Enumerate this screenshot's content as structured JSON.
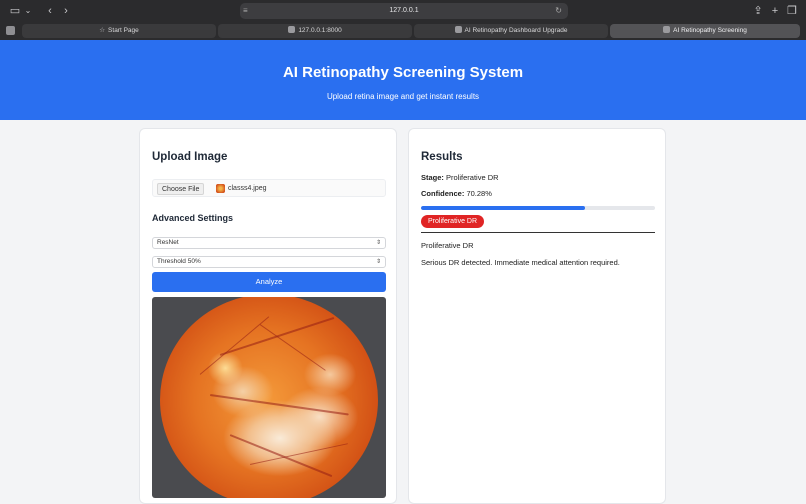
{
  "browser": {
    "url": "127.0.0.1",
    "tabs": [
      {
        "label": "Start Page"
      },
      {
        "label": "127.0.0.1:8000"
      },
      {
        "label": "AI Retinopathy Dashboard Upgrade"
      },
      {
        "label": "AI Retinopathy Screening",
        "active": true
      }
    ]
  },
  "header": {
    "title": "AI Retinopathy Screening System",
    "subtitle": "Upload retina image and get instant results",
    "color": "#2a6ff0"
  },
  "upload": {
    "heading": "Upload Image",
    "choose_file_label": "Choose File",
    "file_name": "classs4.jpeg",
    "advanced_heading": "Advanced Settings",
    "model_select": "ResNet",
    "threshold_select": "Threshold 50%",
    "analyze_label": "Analyze"
  },
  "results": {
    "heading": "Results",
    "stage_label": "Stage:",
    "stage_value": "Proliferative DR",
    "confidence_label": "Confidence:",
    "confidence_value": "70.28%",
    "confidence_fraction": 0.7028,
    "badge": "Proliferative DR",
    "badge_color": "#e02424",
    "summary": "Proliferative DR",
    "message": "Serious DR detected. Immediate medical attention required."
  }
}
